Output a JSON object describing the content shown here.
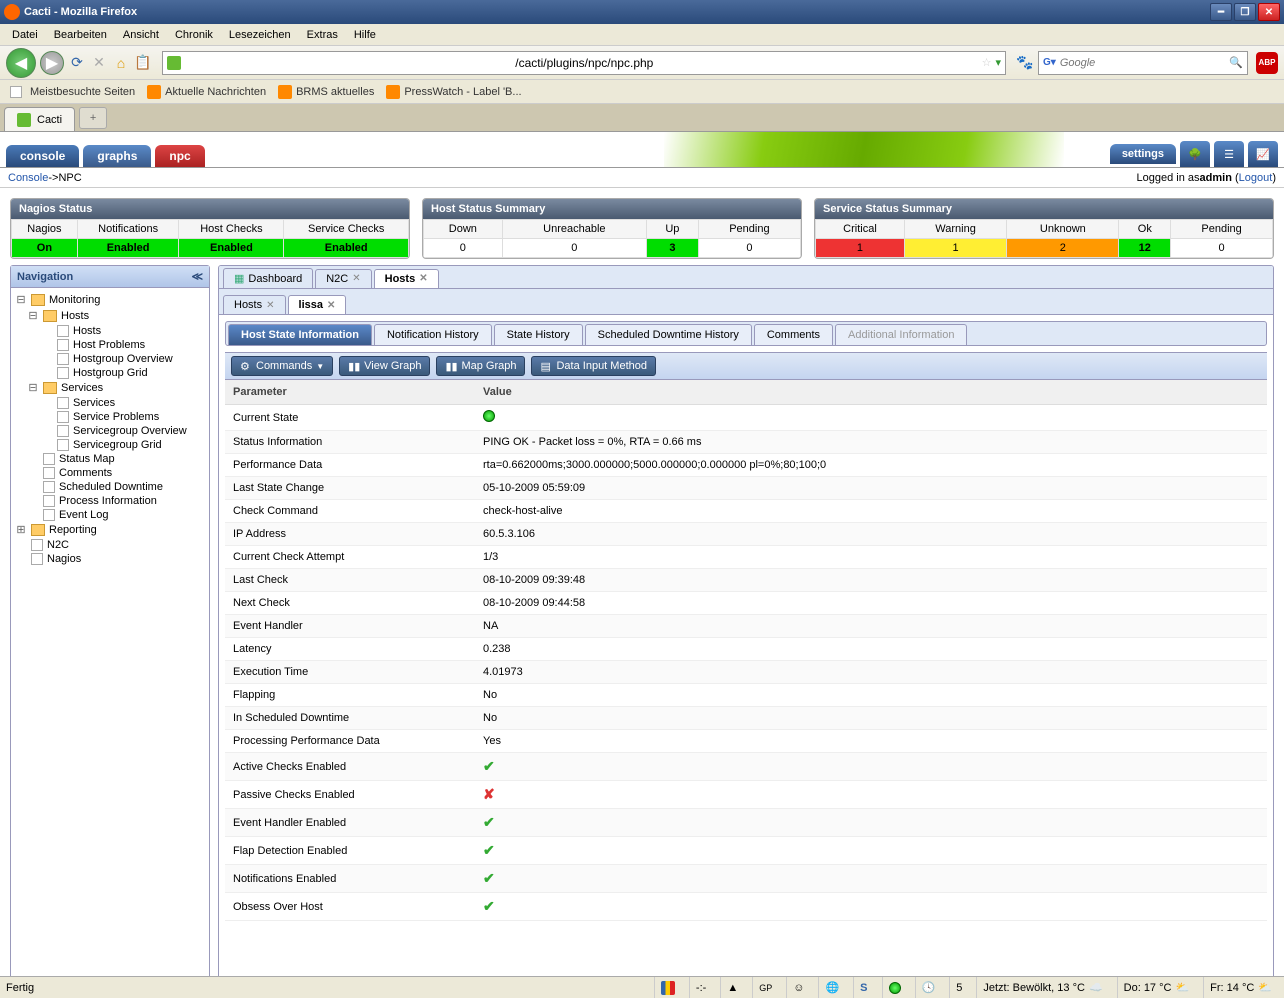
{
  "window": {
    "title": "Cacti - Mozilla Firefox"
  },
  "menu": {
    "items": [
      "Datei",
      "Bearbeiten",
      "Ansicht",
      "Chronik",
      "Lesezeichen",
      "Extras",
      "Hilfe"
    ]
  },
  "url": "/cacti/plugins/npc/npc.php",
  "search_placeholder": "Google",
  "bookmarks": [
    "Meistbesuchte Seiten",
    "Aktuelle Nachrichten",
    "BRMS aktuelles",
    "PressWatch - Label 'B..."
  ],
  "browser_tab": "Cacti",
  "cacti_tabs": {
    "console": "console",
    "graphs": "graphs",
    "npc": "npc",
    "settings": "settings"
  },
  "crumb": {
    "left1": "Console",
    "sep": " -> ",
    "left2": "NPC",
    "right_pre": "Logged in as ",
    "user": "admin",
    "logout": "Logout"
  },
  "nagios_status": {
    "title": "Nagios Status",
    "headers": [
      "Nagios",
      "Notifications",
      "Host Checks",
      "Service Checks"
    ],
    "values": [
      "On",
      "Enabled",
      "Enabled",
      "Enabled"
    ]
  },
  "host_status": {
    "title": "Host Status Summary",
    "headers": [
      "Down",
      "Unreachable",
      "Up",
      "Pending"
    ],
    "values": [
      "0",
      "0",
      "3",
      "0"
    ]
  },
  "service_status": {
    "title": "Service Status Summary",
    "headers": [
      "Critical",
      "Warning",
      "Unknown",
      "Ok",
      "Pending"
    ],
    "values": [
      "1",
      "1",
      "2",
      "12",
      "0"
    ]
  },
  "nav_title": "Navigation",
  "tree": {
    "monitoring": "Monitoring",
    "hosts_folder": "Hosts",
    "hosts": "Hosts",
    "host_problems": "Host Problems",
    "hostgroup_overview": "Hostgroup Overview",
    "hostgroup_grid": "Hostgroup Grid",
    "services_folder": "Services",
    "services": "Services",
    "service_problems": "Service Problems",
    "servicegroup_overview": "Servicegroup Overview",
    "servicegroup_grid": "Servicegroup Grid",
    "status_map": "Status Map",
    "comments": "Comments",
    "scheduled_downtime": "Scheduled Downtime",
    "process_information": "Process Information",
    "event_log": "Event Log",
    "reporting": "Reporting",
    "n2c": "N2C",
    "nagios": "Nagios"
  },
  "content_tabs": {
    "dashboard": "Dashboard",
    "n2c": "N2C",
    "hosts": "Hosts"
  },
  "sub_tabs": {
    "hosts": "Hosts",
    "lissa": "lissa"
  },
  "inner_tabs": {
    "host_state": "Host State Information",
    "notif": "Notification History",
    "state_hist": "State History",
    "downtime": "Scheduled Downtime History",
    "comments": "Comments",
    "add_info": "Additional Information"
  },
  "toolbar": {
    "commands": "Commands",
    "view_graph": "View Graph",
    "map_graph": "Map Graph",
    "data_input": "Data Input Method"
  },
  "table_headers": {
    "param": "Parameter",
    "value": "Value"
  },
  "rows": [
    {
      "p": "Current State",
      "v": "__greenball__"
    },
    {
      "p": "Status Information",
      "v": "PING OK - Packet loss = 0%, RTA = 0.66 ms"
    },
    {
      "p": "Performance Data",
      "v": "rta=0.662000ms;3000.000000;5000.000000;0.000000 pl=0%;80;100;0"
    },
    {
      "p": "Last State Change",
      "v": "05-10-2009 05:59:09"
    },
    {
      "p": "Check Command",
      "v": "check-host-alive"
    },
    {
      "p": "IP Address",
      "v": "60.5.3.106"
    },
    {
      "p": "Current Check Attempt",
      "v": "1/3"
    },
    {
      "p": "Last Check",
      "v": "08-10-2009 09:39:48"
    },
    {
      "p": "Next Check",
      "v": "08-10-2009 09:44:58"
    },
    {
      "p": "Event Handler",
      "v": "NA"
    },
    {
      "p": "Latency",
      "v": "0.238"
    },
    {
      "p": "Execution Time",
      "v": "4.01973"
    },
    {
      "p": "Flapping",
      "v": "No"
    },
    {
      "p": "In Scheduled Downtime",
      "v": "No"
    },
    {
      "p": "Processing Performance Data",
      "v": "Yes"
    },
    {
      "p": "Active Checks Enabled",
      "v": "__check__"
    },
    {
      "p": "Passive Checks Enabled",
      "v": "__cross__"
    },
    {
      "p": "Event Handler Enabled",
      "v": "__check__"
    },
    {
      "p": "Flap Detection Enabled",
      "v": "__check__"
    },
    {
      "p": "Notifications Enabled",
      "v": "__check__"
    },
    {
      "p": "Obsess Over Host",
      "v": "__check__"
    }
  ],
  "statusbar": {
    "left": "Fertig",
    "temp_hint": "-:-",
    "weather1": "Jetzt: Bewölkt, 13 °C",
    "weather2": "Do: 17 °C",
    "weather3": "Fr: 14 °C"
  }
}
